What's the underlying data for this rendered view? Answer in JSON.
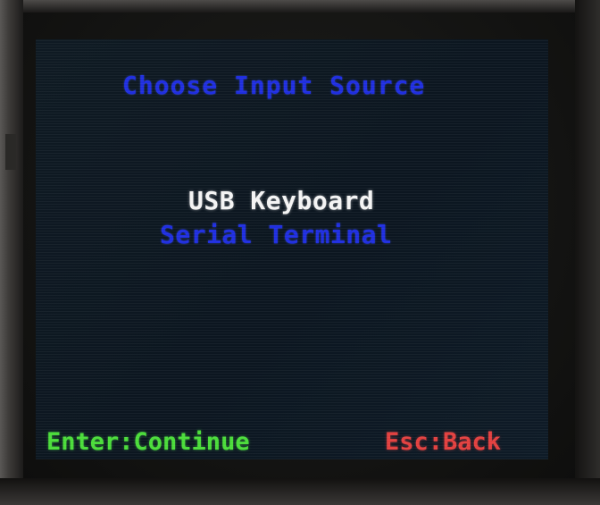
{
  "screen": {
    "title": "Choose Input Source",
    "menu": {
      "items": [
        {
          "label": "USB Keyboard",
          "selected": true
        },
        {
          "label": "Serial Terminal",
          "selected": false
        }
      ]
    },
    "footer": {
      "enter_hint": "Enter:Continue",
      "esc_hint": "Esc:Back"
    }
  },
  "colors": {
    "background": "#0f1a23",
    "title": "#1f2ee0",
    "selected_item": "#f4f4f4",
    "unselected_item": "#1f2ee0",
    "enter_hint": "#4bdc3a",
    "esc_hint": "#e2403f"
  }
}
